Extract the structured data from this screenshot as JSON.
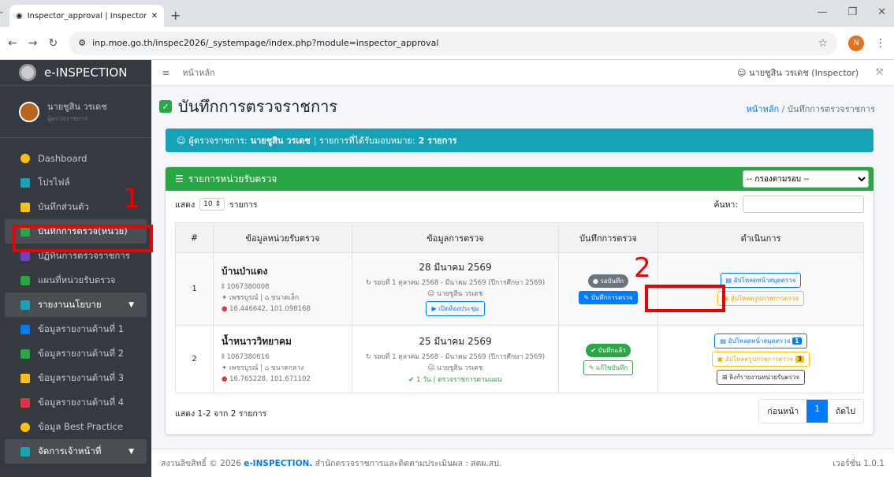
{
  "browser": {
    "tab_title": "Inspector_approval | Inspector",
    "new_tab": "+",
    "url": "inp.moe.go.th/inspec2026/_systempage/index.php?module=inspector_approval",
    "profile_initial": "N"
  },
  "sidebar": {
    "brand": "e-INSPECTION",
    "user_name": "นายชูสิน วรเดช",
    "user_role": "ผู้ตรวจราชการ",
    "items": [
      {
        "label": "Dashboard",
        "color": "#ffc107"
      },
      {
        "label": "โปรไฟล์",
        "color": "#17a2b8"
      },
      {
        "label": "บันทึกส่วนตัว",
        "color": "#ffc107"
      },
      {
        "label": "บันทึกการตรวจ(หน่วย)",
        "color": "#28a745"
      },
      {
        "label": "ปฏิทินการตรวจราชการ",
        "color": "#6f42c1"
      },
      {
        "label": "แผนที่หน่วยรับตรวจ",
        "color": "#28a745"
      },
      {
        "label": "รายงานนโยบาย",
        "color": "#17a2b8"
      },
      {
        "label": "ข้อมูลรายงานด้านที่ 1",
        "color": "#007bff"
      },
      {
        "label": "ข้อมูลรายงานด้านที่ 2",
        "color": "#28a745"
      },
      {
        "label": "ข้อมูลรายงานด้านที่ 3",
        "color": "#ffc107"
      },
      {
        "label": "ข้อมูลรายงานด้านที่ 4",
        "color": "#dc3545"
      },
      {
        "label": "ข้อมูล Best Practice",
        "color": "#ffc107"
      },
      {
        "label": "จัดการเจ้าหน้าที่",
        "color": "#17a2b8"
      }
    ]
  },
  "topbar": {
    "home": "หน้าหลัก",
    "user": "นายชูสิน วรเดช (Inspector)"
  },
  "page": {
    "title": "บันทึกการตรวจราชการ",
    "breadcrumb_home": "หน้าหลัก",
    "breadcrumb_current": "บันทึกการตรวจราชการ",
    "info_prefix": "ผู้ตรวจราชการ:",
    "info_name": "นายชูสิน วรเดช",
    "info_mid": "| รายการที่ได้รับมอบหมาย:",
    "info_count": "2 รายการ"
  },
  "card": {
    "title": "รายการหน่วยรับตรวจ",
    "filter_default": "-- กรองตามรอบ --",
    "show_label": "แสดง",
    "show_value": "10",
    "show_suffix": "รายการ",
    "search_label": "ค้นหา:",
    "headers": [
      "#",
      "ข้อมูลหน่วยรับตรวจ",
      "ข้อมูลการตรวจ",
      "บันทึกการตรวจ",
      "ดำเนินการ"
    ],
    "rows": [
      {
        "no": "1",
        "school": "บ้านป่าแดง",
        "code": "1067380008",
        "province": "เพชรบูรณ์",
        "size": "ขนาดเล็ก",
        "coords": "16.446642, 101.098168",
        "date": "28 มีนาคม 2569",
        "round": "รอบที่ 1 ตุลาคม 2568 - มีนาคม 2569 (ปีการศึกษา 2569)",
        "inspector": "นายชูสิน วรเดช",
        "extra": "เปิดห้องประชุม",
        "status": "รอบันทึก",
        "record_btn": "บันทึกการตรวจ",
        "actions": [
          "อัปโหลดหน้าสมุดตรวจ",
          "อัปโหลดรูปภาพการตรวจ"
        ]
      },
      {
        "no": "2",
        "school": "น้ำหนาววิทยาคม",
        "code": "1067380616",
        "province": "เพชรบูรณ์",
        "size": "ขนาดกลาง",
        "coords": "16.765228, 101.671102",
        "date": "25 มีนาคม 2569",
        "round": "รอบที่ 1 ตุลาคม 2568 - มีนาคม 2569 (ปีการศึกษา 2569)",
        "inspector": "นายชูสิน วรเดช",
        "extra": "1 วัน | ตรวจราชการตามแผน",
        "status": "บันทึกแล้ว",
        "record_btn": "แก้ไขบันทึก",
        "actions": [
          "อัปโหลดหน้าสมุดตรวจ",
          "อัปโหลดรูปภาพการตรวจ",
          "ลิงก์รายงานหน่วยรับตรวจ"
        ],
        "action_badges": [
          "1",
          "3"
        ]
      }
    ],
    "summary": "แสดง 1-2 จาก 2 รายการ",
    "prev": "ก่อนหน้า",
    "page": "1",
    "next": "ถัดไป"
  },
  "footer": {
    "copyright": "สงวนลิขสิทธิ์ © 2026",
    "brand": "e-INSPECTION.",
    "org": "สำนักตรวจราชการและติดตามประเมินผล : สตผ.สป.",
    "version": "เวอร์ชั่น 1.0.1"
  },
  "annotations": {
    "one": "1",
    "two": "2"
  }
}
